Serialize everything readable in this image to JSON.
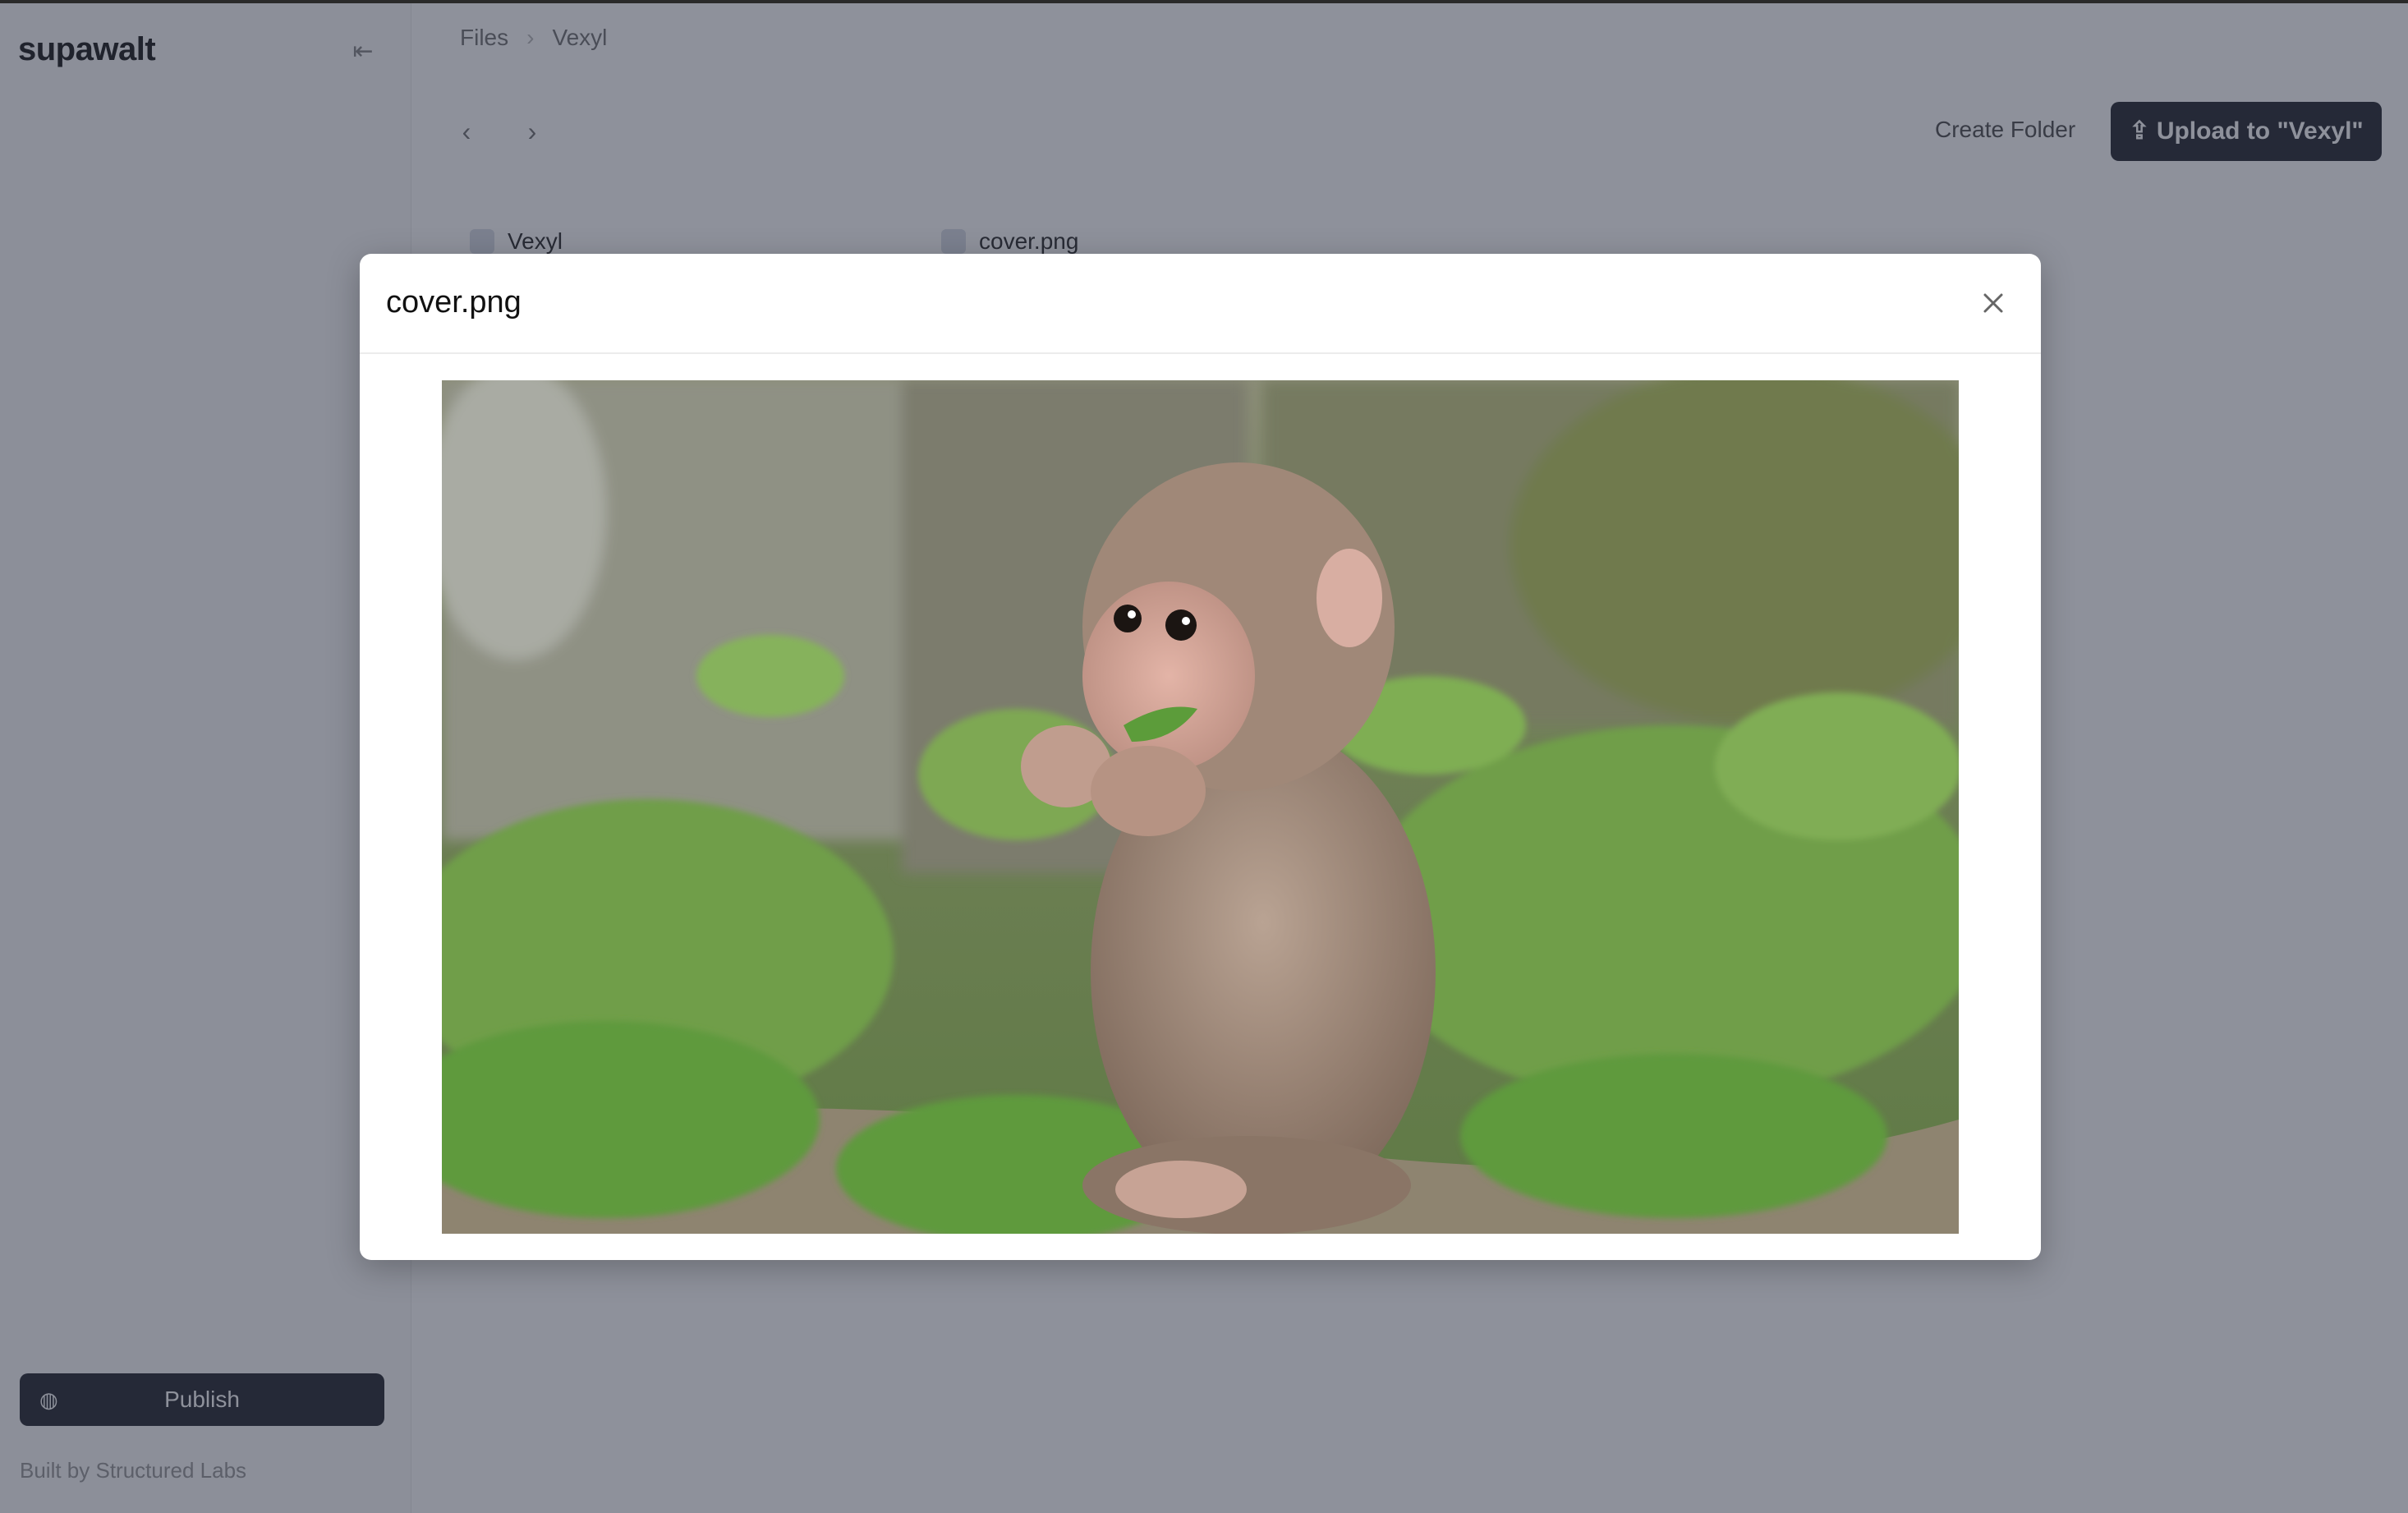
{
  "app": {
    "brand": "supawalt",
    "breadcrumb": [
      "Files",
      "Vexyl"
    ],
    "create_folder_label": "Create Folder",
    "upload_label": "Upload to \"Vexyl\"",
    "files": [
      "Vexyl",
      "cover.png"
    ],
    "publish_label": "Publish",
    "footer_text": "Built by Structured Labs"
  },
  "modal": {
    "title": "cover.png",
    "image_alt": "Baby monkey sitting in green grass, eating a leaf"
  },
  "colors": {
    "overlay": "#1e2438",
    "primary_button": "#2c2f36"
  },
  "icons": {
    "close": "close-icon",
    "collapse": "sidebar-toggle-icon",
    "back": "arrow-left-icon",
    "forward": "arrow-right-icon",
    "upload": "upload-icon",
    "publish": "globe-icon",
    "file": "file-icon"
  }
}
